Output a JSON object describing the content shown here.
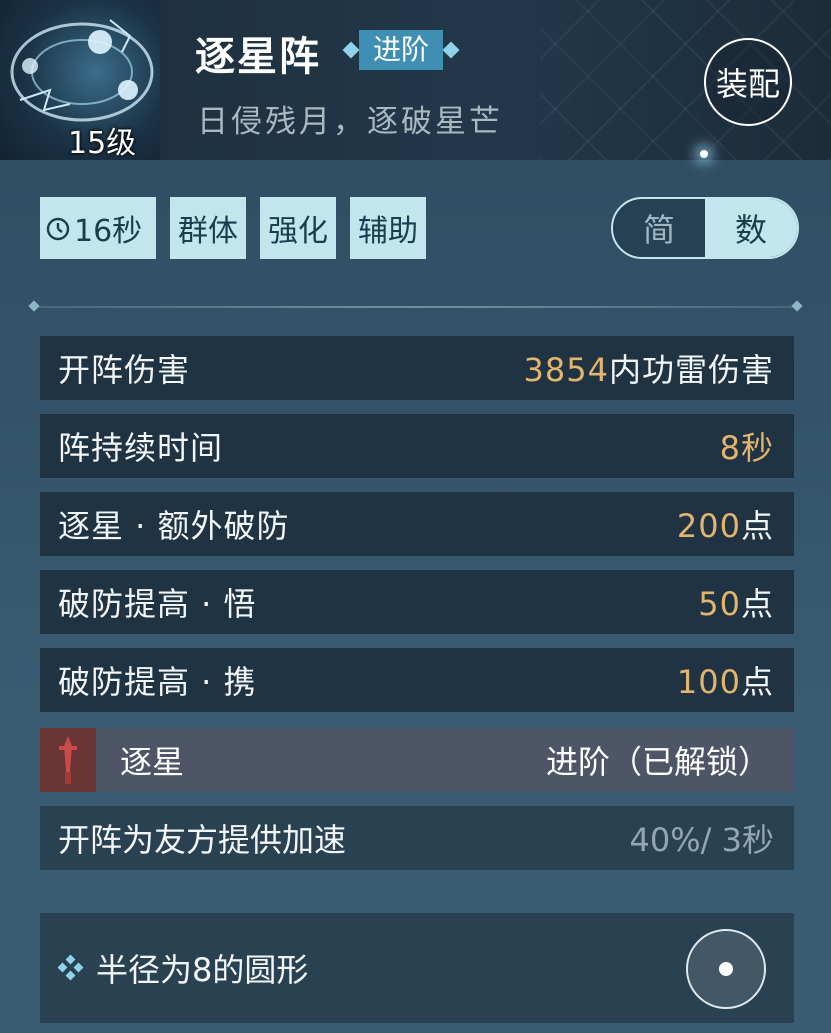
{
  "skill": {
    "name": "逐星阵",
    "tier": "进阶",
    "subtitle": "日侵残月，逐破星芒",
    "level": "15级"
  },
  "equip_label": "装配",
  "tags": {
    "timer": "16秒",
    "target": "群体",
    "type1": "强化",
    "type2": "辅助"
  },
  "view_toggle": {
    "simple": "简",
    "numeric": "数",
    "selected": "数"
  },
  "stats": [
    {
      "label": "开阵伤害",
      "num": "3854",
      "unit": "内功雷伤害"
    },
    {
      "label": "阵持续时间",
      "num": "8",
      "unit": "秒"
    },
    {
      "label": "逐星 · 额外破防",
      "num": "200",
      "unit": "点"
    },
    {
      "label": "破防提高 · 悟",
      "num": "50",
      "unit": "点"
    },
    {
      "label": "破防提高 · 携",
      "num": "100",
      "unit": "点"
    }
  ],
  "unlock": {
    "name": "逐星",
    "state": "进阶（已解锁）",
    "effect_label": "开阵为友方提供加速",
    "effect_value": "40%/ 3秒"
  },
  "range": {
    "label": "半径为8的圆形"
  },
  "colors": {
    "accent": "#3f8fb4",
    "tag_bg": "#c3e6ee",
    "value_gold": "#e3b46e",
    "unlock_red": "#6a3434"
  }
}
